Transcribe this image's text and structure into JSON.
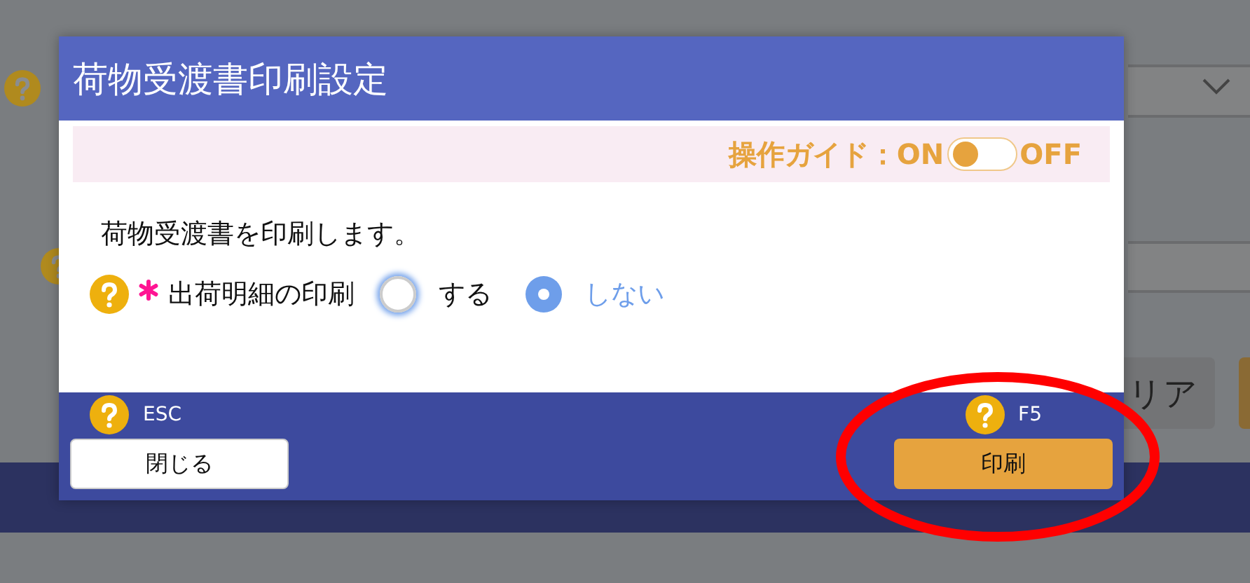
{
  "background": {
    "button_label": "リア"
  },
  "dialog": {
    "title": "荷物受渡書印刷設定",
    "guide": {
      "label": "操作ガイド：",
      "on_label": "ON",
      "off_label": "OFF",
      "on": true
    },
    "message": "荷物受渡書を印刷します。",
    "field": {
      "label": "出荷明細の印刷",
      "required": true,
      "options": [
        {
          "label": "する",
          "selected": false,
          "focused": true
        },
        {
          "label": "しない",
          "selected": true,
          "focused": false
        }
      ]
    },
    "footer": [
      {
        "key": "ESC",
        "label": "閉じる",
        "kind": "secondary"
      },
      {
        "key": "F5",
        "label": "印刷",
        "kind": "primary"
      }
    ]
  }
}
